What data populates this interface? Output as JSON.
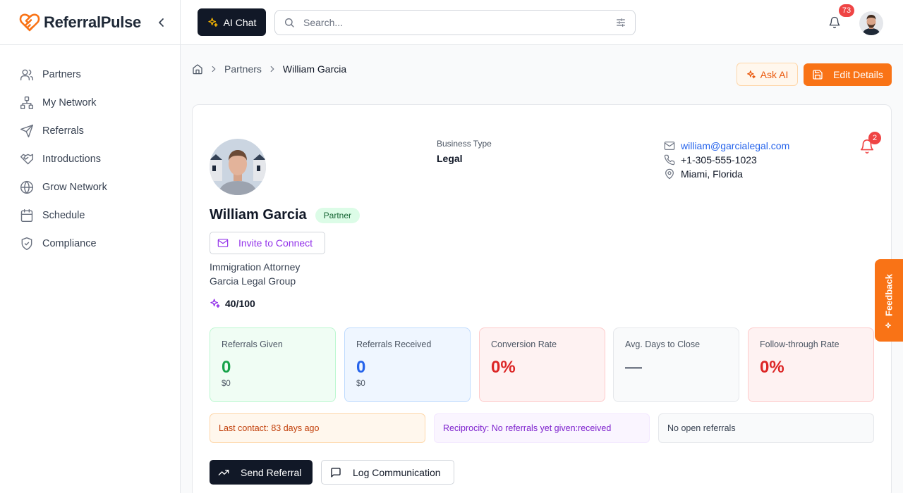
{
  "brand": {
    "name": "ReferralPulse"
  },
  "sidebar": {
    "items": [
      {
        "label": "Partners",
        "icon": "users-icon"
      },
      {
        "label": "My Network",
        "icon": "network-icon"
      },
      {
        "label": "Referrals",
        "icon": "send-icon"
      },
      {
        "label": "Introductions",
        "icon": "handshake-icon"
      },
      {
        "label": "Grow Network",
        "icon": "globe-icon"
      },
      {
        "label": "Schedule",
        "icon": "calendar-icon"
      },
      {
        "label": "Compliance",
        "icon": "shield-icon"
      }
    ]
  },
  "topbar": {
    "ai_chat_label": "AI Chat",
    "search_placeholder": "Search...",
    "notification_count": "73"
  },
  "breadcrumb": {
    "parent": "Partners",
    "current": "William Garcia"
  },
  "actions": {
    "ask_ai": "Ask AI",
    "edit_details": "Edit Details"
  },
  "profile": {
    "name": "William Garcia",
    "role": "Partner",
    "invite_label": "Invite to Connect",
    "job_title": "Immigration Attorney",
    "company": "Garcia Legal Group",
    "score": "40/100",
    "business_type_label": "Business Type",
    "business_type": "Legal",
    "email": "william@garcialegal.com",
    "phone": "+1-305-555-1023",
    "location": "Miami, Florida",
    "alert_count": "2"
  },
  "stats": [
    {
      "label": "Referrals Given",
      "value": "0",
      "sub": "$0",
      "bg": "#f0fdf4",
      "border": "#bbf7d0",
      "color": "#16a34a"
    },
    {
      "label": "Referrals Received",
      "value": "0",
      "sub": "$0",
      "bg": "#eff6ff",
      "border": "#bfdbfe",
      "color": "#2563eb"
    },
    {
      "label": "Conversion Rate",
      "value": "0%",
      "sub": "",
      "bg": "#fef2f2",
      "border": "#fecaca",
      "color": "#dc2626"
    },
    {
      "label": "Avg. Days to Close",
      "value": "—",
      "sub": "",
      "bg": "#f9fafb",
      "border": "#e5e7eb",
      "color": "#6b7280"
    },
    {
      "label": "Follow-through Rate",
      "value": "0%",
      "sub": "",
      "bg": "#fef2f2",
      "border": "#fecaca",
      "color": "#dc2626"
    }
  ],
  "info": {
    "last_contact": "Last contact: 83 days ago",
    "reciprocity": "Reciprocity: No referrals yet given:received",
    "open_referrals": "No open referrals"
  },
  "buttons": {
    "send_referral": "Send Referral",
    "log_communication": "Log Communication"
  },
  "feedback_label": "Feedback",
  "colors": {
    "accent": "#f97316",
    "dark": "#111827",
    "link": "#2563eb",
    "purple": "#9333ea",
    "danger": "#ef4444"
  }
}
